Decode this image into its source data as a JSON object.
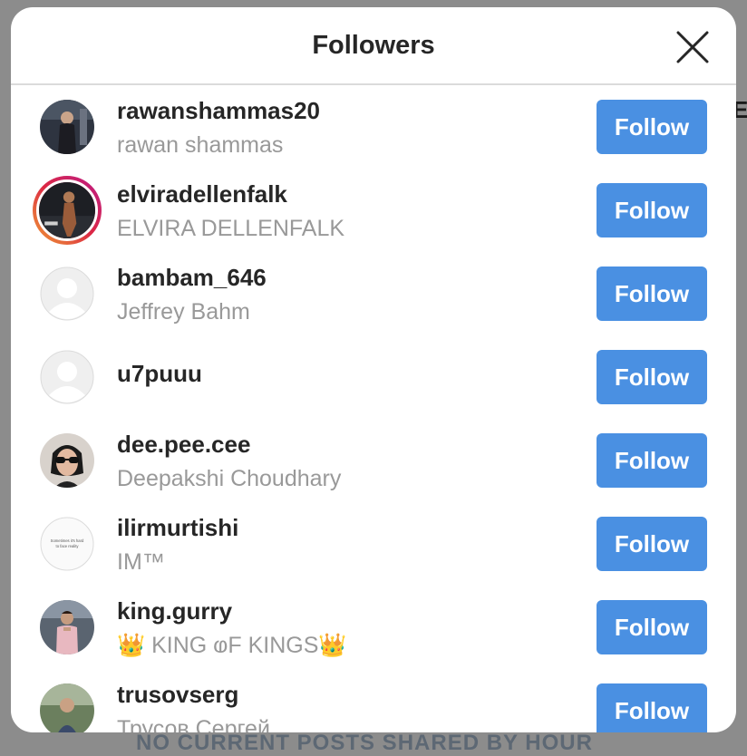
{
  "backdrop": {
    "edge_text": "EB",
    "bottom_text": "NO CURRENT POSTS SHARED BY HOUR"
  },
  "modal": {
    "title": "Followers"
  },
  "followers": [
    {
      "username": "rawanshammas20",
      "full_name": "rawan shammas",
      "button": "Follow",
      "avatar": "photo-dark"
    },
    {
      "username": "elviradellenfalk",
      "full_name": "ELVIRA DELLENFALK",
      "button": "Follow",
      "avatar": "photo-stage"
    },
    {
      "username": "bambam_646",
      "full_name": "Jeffrey Bahm",
      "button": "Follow",
      "avatar": "default"
    },
    {
      "username": "u7puuu",
      "full_name": "",
      "button": "Follow",
      "avatar": "default"
    },
    {
      "username": "dee.pee.cee",
      "full_name": "Deepakshi Choudhary",
      "button": "Follow",
      "avatar": "photo-sunglasses"
    },
    {
      "username": "ilirmurtishi",
      "full_name": "IM™",
      "button": "Follow",
      "avatar": "text-quote"
    },
    {
      "username": "king.gurry",
      "full_name": "👑 KING ⱷF KINGS👑",
      "button": "Follow",
      "avatar": "photo-person"
    },
    {
      "username": "trusovserg",
      "full_name": "Трусов Сергей",
      "button": "Follow",
      "avatar": "photo-outdoor"
    }
  ],
  "avatar_quote_text": [
    "Sometimes it's hard",
    "to face reality"
  ],
  "colors": {
    "follow_button": "#4a90e2",
    "username": "#262626",
    "secondary": "#999999"
  }
}
